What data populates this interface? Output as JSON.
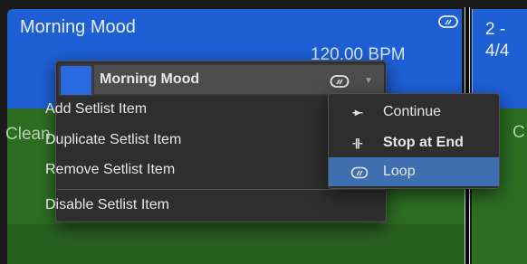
{
  "track": {
    "title": "Morning Mood",
    "bpm": "120.00 BPM",
    "next_label_line1": "2 -",
    "next_label_line2": "4/4",
    "lower_label": "Clean",
    "lower_label_next": "C"
  },
  "colors": {
    "region_blue": "#1e5fd4",
    "region_green": "#2c6d22",
    "menu_bg": "#2e2e2e",
    "highlight": "#3f6fb1"
  },
  "context_menu": {
    "header_title": "Morning Mood",
    "items": [
      "Add Setlist Item",
      "Duplicate Setlist Item",
      "Remove Setlist Item",
      "Disable Setlist Item"
    ]
  },
  "submenu": {
    "items": [
      {
        "glyph": "-▸-",
        "label": "Continue",
        "icon": "continue-icon"
      },
      {
        "glyph": "-||-",
        "label": "Stop at End",
        "icon": "stop-at-end-icon"
      },
      {
        "glyph": "",
        "label": "Loop",
        "icon": "loop-icon",
        "selected": true
      }
    ]
  }
}
